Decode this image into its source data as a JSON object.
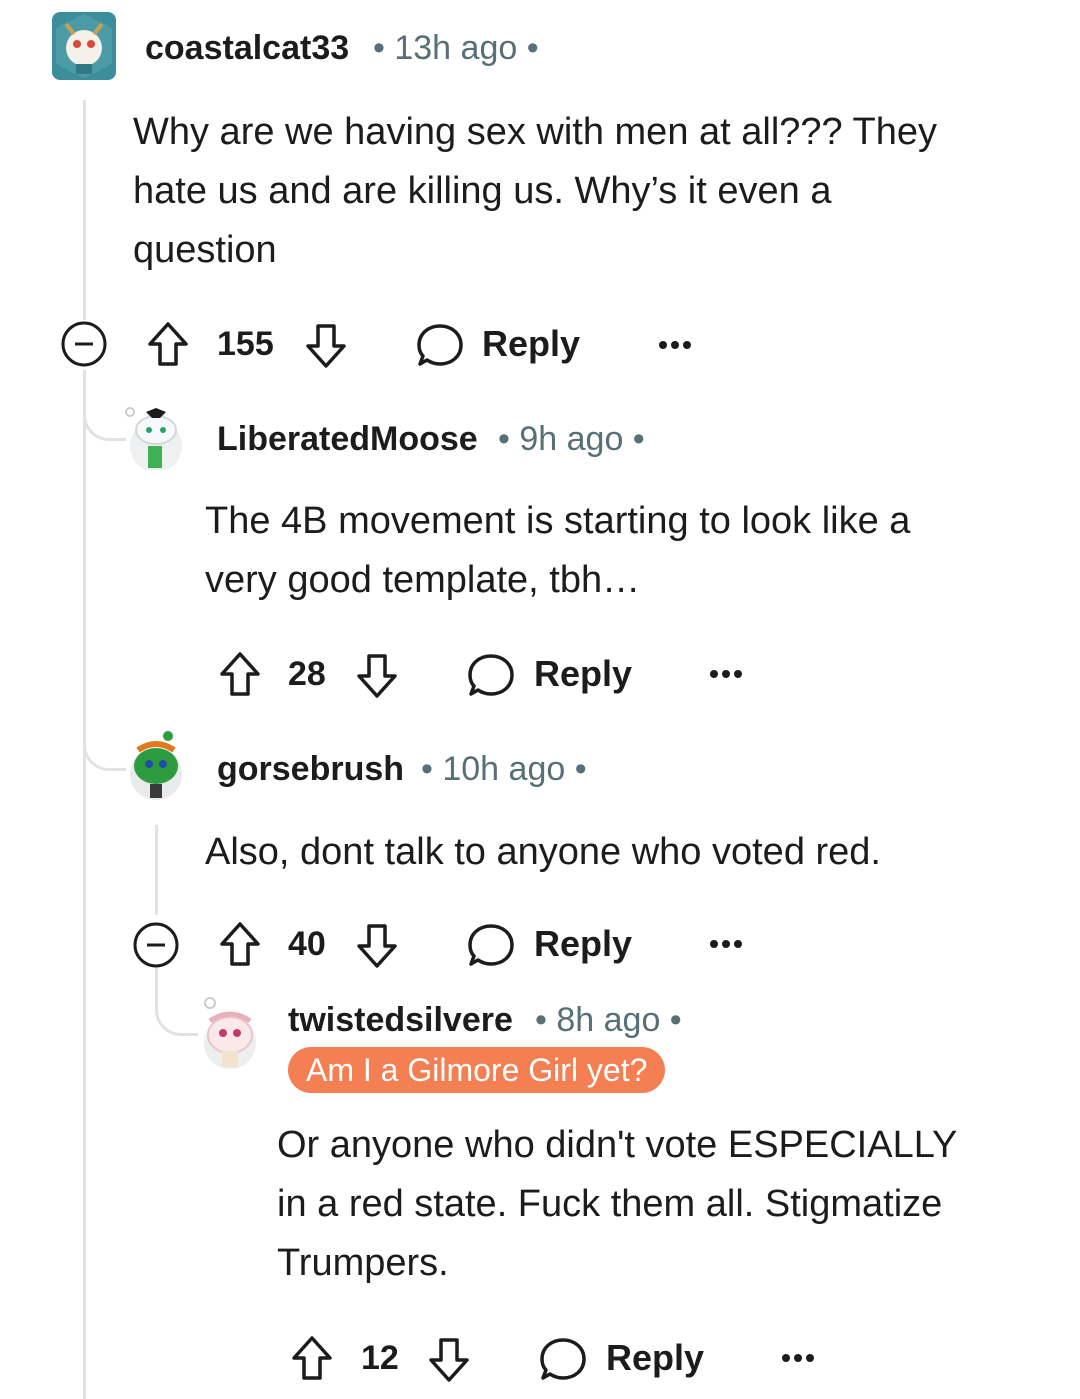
{
  "comments": [
    {
      "username": "coastalcat33",
      "time": "13h ago",
      "body_lines": [
        "Why are we having sex with men at all??? They",
        "hate us and are killing us. Why’s it even a",
        "question"
      ],
      "votes": "155",
      "reply_label": "Reply"
    },
    {
      "username": "LiberatedMoose",
      "time": "9h ago",
      "body_lines": [
        "The 4B movement is starting to look like a",
        "very good template, tbh…"
      ],
      "votes": "28",
      "reply_label": "Reply"
    },
    {
      "username": "gorsebrush",
      "time": "10h ago",
      "body_lines": [
        "Also, dont talk to anyone who voted red."
      ],
      "votes": "40",
      "reply_label": "Reply"
    },
    {
      "username": "twistedsilvere",
      "time": "8h ago",
      "flair": "Am I a Gilmore Girl yet?",
      "body_lines": [
        "Or anyone who didn't vote ESPECIALLY",
        "in a red state. Fuck them all. Stigmatize",
        "Trumpers."
      ],
      "votes": "12",
      "reply_label": "Reply"
    }
  ],
  "colors": {
    "flair_bg": "#f47f52",
    "meta_text": "#576f76",
    "thread_line": "#e0e3e6"
  }
}
